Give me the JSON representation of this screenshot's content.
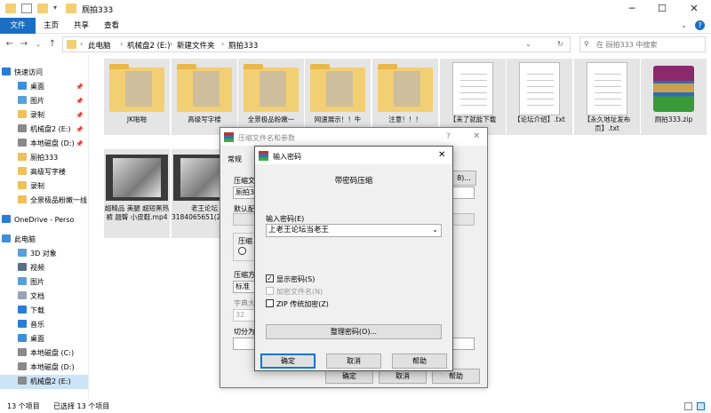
{
  "window": {
    "title": "厕拍333"
  },
  "ribbon": {
    "tabs": [
      "文件",
      "主页",
      "共享",
      "查看"
    ]
  },
  "address": {
    "crumbs": [
      "此电脑",
      "机械盘2 (E:)",
      "新建文件夹",
      "厕拍333"
    ],
    "search_placeholder": "在 厕拍333 中搜索"
  },
  "nav": {
    "items": [
      {
        "label": "快速访问",
        "icon": "star-icon",
        "color": "#2b7cd3"
      },
      {
        "label": "桌面",
        "icon": "desktop-icon",
        "color": "#3d8fd8",
        "pin": "📌"
      },
      {
        "label": "图片",
        "icon": "pictures-icon",
        "color": "#5aa0d8",
        "pin": "📌"
      },
      {
        "label": "录制",
        "icon": "folder-icon",
        "color": "#f0c05a",
        "pin": "📌"
      },
      {
        "label": "机械盘2 (E:)",
        "icon": "drive-icon",
        "color": "#8a8a8a",
        "pin": "📌"
      },
      {
        "label": "本地磁盘 (D:)",
        "icon": "drive-icon",
        "color": "#8a8a8a",
        "pin": "📌"
      },
      {
        "label": "厕拍333",
        "icon": "folder-icon",
        "color": "#f0c05a"
      },
      {
        "label": "高级写字楼",
        "icon": "folder-icon",
        "color": "#f0c05a"
      },
      {
        "label": "录制",
        "icon": "folder-icon",
        "color": "#f0c05a"
      },
      {
        "label": "全景极品粉嫩一线",
        "icon": "folder-icon",
        "color": "#f0c05a"
      },
      {
        "label": "OneDrive - Perso",
        "icon": "cloud-icon",
        "color": "#2b7cd3"
      },
      {
        "label": "此电脑",
        "icon": "computer-icon",
        "color": "#3d8fd8"
      },
      {
        "label": "3D 对象",
        "icon": "3d-objects-icon",
        "color": "#5aa0d8"
      },
      {
        "label": "视频",
        "icon": "videos-icon",
        "color": "#5a6f88"
      },
      {
        "label": "图片",
        "icon": "pictures-icon",
        "color": "#5aa0d8"
      },
      {
        "label": "文档",
        "icon": "documents-icon",
        "color": "#9aa4b0"
      },
      {
        "label": "下载",
        "icon": "download-icon",
        "color": "#2b7cd3"
      },
      {
        "label": "音乐",
        "icon": "music-icon",
        "color": "#2b7cd3"
      },
      {
        "label": "桌面",
        "icon": "desktop-icon",
        "color": "#3d8fd8"
      },
      {
        "label": "本地磁盘 (C:)",
        "icon": "drive-icon",
        "color": "#8a8a8a"
      },
      {
        "label": "本地磁盘 (D:)",
        "icon": "drive-icon",
        "color": "#8a8a8a"
      },
      {
        "label": "机械盘2 (E:)",
        "icon": "drive-icon",
        "color": "#8a8a8a"
      }
    ]
  },
  "files": [
    {
      "label": "JK啪啪",
      "kind": "folder"
    },
    {
      "label": "高级写字楼",
      "kind": "folder"
    },
    {
      "label": "全景极品粉嫩一",
      "kind": "folder"
    },
    {
      "label": "网速展示！！牛",
      "kind": "folder"
    },
    {
      "label": "注意！！！",
      "kind": "folder"
    },
    {
      "label": "【来了就能下载",
      "kind": "doc"
    },
    {
      "label": "【论坛介绍】.txt",
      "kind": "doc"
    },
    {
      "label": "【永久地址发布页】.txt",
      "kind": "doc"
    },
    {
      "label": "厕拍333.zip",
      "kind": "zip"
    },
    {
      "label": "超精品 美腿 超短黑热裤 翘臀 小皮鞋.mp4",
      "kind": "video"
    },
    {
      "label": "老王论坛3184065651(2).mp4",
      "kind": "video"
    }
  ],
  "status": {
    "count": "13 个项目",
    "selected": "已选择 13 个项目"
  },
  "archive_dialog": {
    "title": "压缩文件名和参数",
    "tab_general": "常规",
    "archive_name_label": "压缩文",
    "archive_name_value": "厕拍3",
    "default_profile_label": "默认配",
    "format_label": "压缩",
    "method_label": "压缩方",
    "method_value": "标准",
    "dict_label": "字典大",
    "dict_value": "32",
    "split_label": "切分为",
    "browse_label": "8)...",
    "ok": "确定",
    "cancel": "取消",
    "help": "帮助"
  },
  "password_dialog": {
    "title": "输入密码",
    "heading": "带密码压缩",
    "input_label": "输入密码(E)",
    "input_value": "上老王论坛当老王",
    "show_password": "显示密码(S)",
    "encrypt_names": "加密文件名(N)",
    "zip_legacy": "ZIP 传统加密(Z)",
    "organize": "整理密码(O)...",
    "ok": "确定",
    "cancel": "取消",
    "help": "帮助"
  }
}
